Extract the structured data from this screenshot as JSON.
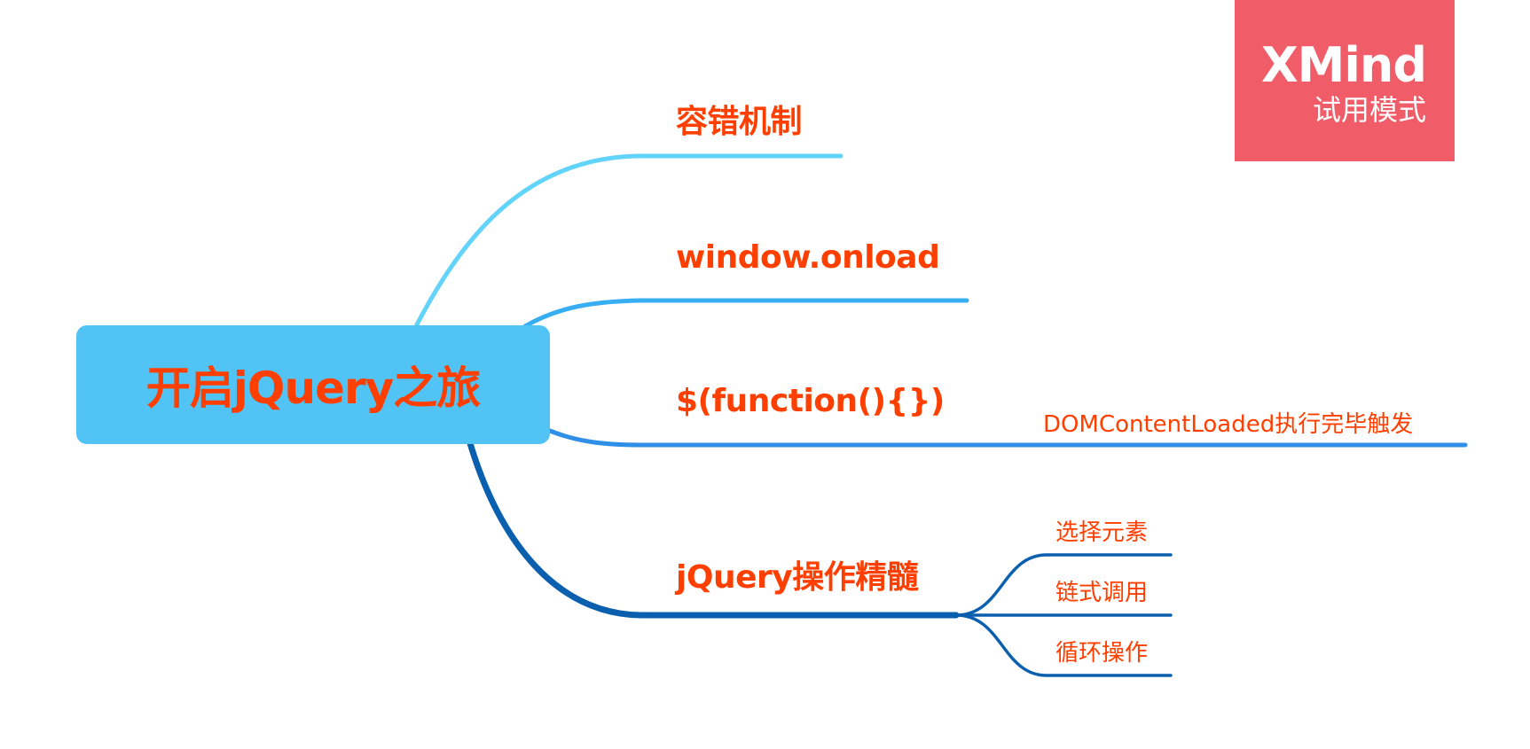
{
  "root": {
    "label": "开启jQuery之旅"
  },
  "topics": [
    {
      "label": "容错机制",
      "color": "#62d3fb"
    },
    {
      "label": "window.onload",
      "color": "#38aef2"
    },
    {
      "label": "$(function(){})",
      "color": "#2f8fe6",
      "children": [
        {
          "label": "DOMContentLoaded执行完毕触发"
        }
      ]
    },
    {
      "label": "jQuery操作精髓",
      "color": "#0a5fae",
      "children": [
        {
          "label": "选择元素"
        },
        {
          "label": "链式调用"
        },
        {
          "label": "循环操作"
        }
      ]
    }
  ],
  "watermark": {
    "brand": "XMind",
    "mode": "试用模式",
    "color": "#f05d68"
  },
  "colors": {
    "root_fill": "#51c3f5",
    "text": "#ff3f00"
  }
}
